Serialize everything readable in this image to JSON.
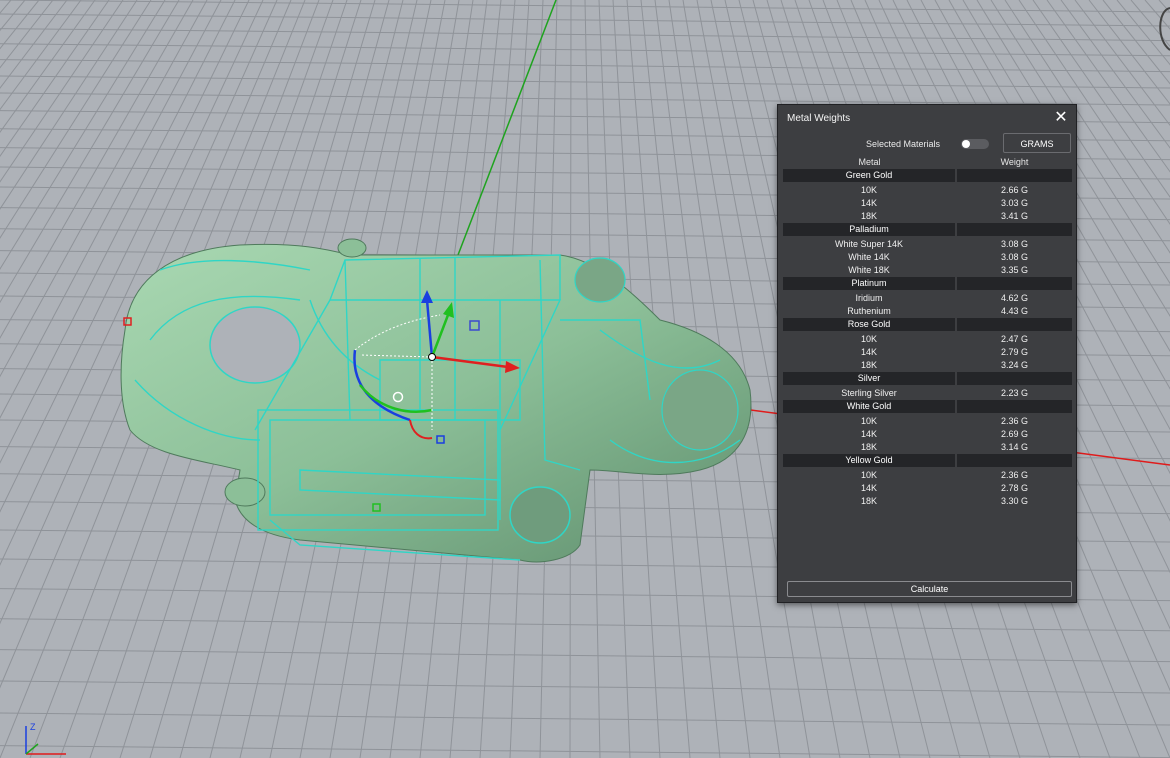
{
  "panel": {
    "title": "Metal Weights",
    "close_icon": "✕",
    "selected_materials_label": "Selected Materials",
    "selected_materials_on": false,
    "units_label": "GRAMS",
    "col_metal": "Metal",
    "col_weight": "Weight",
    "calculate_label": "Calculate",
    "groups": [
      {
        "name": "Green Gold",
        "items": [
          {
            "metal": "10K",
            "weight": "2.66 G"
          },
          {
            "metal": "14K",
            "weight": "3.03 G"
          },
          {
            "metal": "18K",
            "weight": "3.41 G"
          }
        ]
      },
      {
        "name": "Palladium",
        "items": [
          {
            "metal": "White Super 14K",
            "weight": "3.08 G"
          },
          {
            "metal": "White 14K",
            "weight": "3.08 G"
          },
          {
            "metal": "White 18K",
            "weight": "3.35 G"
          }
        ]
      },
      {
        "name": "Platinum",
        "items": [
          {
            "metal": "Iridium",
            "weight": "4.62 G"
          },
          {
            "metal": "Ruthenium",
            "weight": "4.43 G"
          }
        ]
      },
      {
        "name": "Rose Gold",
        "items": [
          {
            "metal": "10K",
            "weight": "2.47 G"
          },
          {
            "metal": "14K",
            "weight": "2.79 G"
          },
          {
            "metal": "18K",
            "weight": "3.24 G"
          }
        ]
      },
      {
        "name": "Silver",
        "items": [
          {
            "metal": "Sterling Silver",
            "weight": "2.23 G"
          }
        ]
      },
      {
        "name": "White Gold",
        "items": [
          {
            "metal": "10K",
            "weight": "2.36 G"
          },
          {
            "metal": "14K",
            "weight": "2.69 G"
          },
          {
            "metal": "18K",
            "weight": "3.14 G"
          }
        ]
      },
      {
        "name": "Yellow Gold",
        "items": [
          {
            "metal": "10K",
            "weight": "2.36 G"
          },
          {
            "metal": "14K",
            "weight": "2.78 G"
          },
          {
            "metal": "18K",
            "weight": "3.30 G"
          }
        ]
      }
    ]
  },
  "viewport": {
    "axis_z_label": "Z",
    "colors": {
      "background": "#aeb2b8",
      "grid": "#8e9298",
      "model_fill": "#8fc29a",
      "wireframe": "#2fd6c6",
      "x_axis": "#e02020",
      "y_axis": "#20a020",
      "gizmo_blue": "#1a3fe0"
    }
  }
}
